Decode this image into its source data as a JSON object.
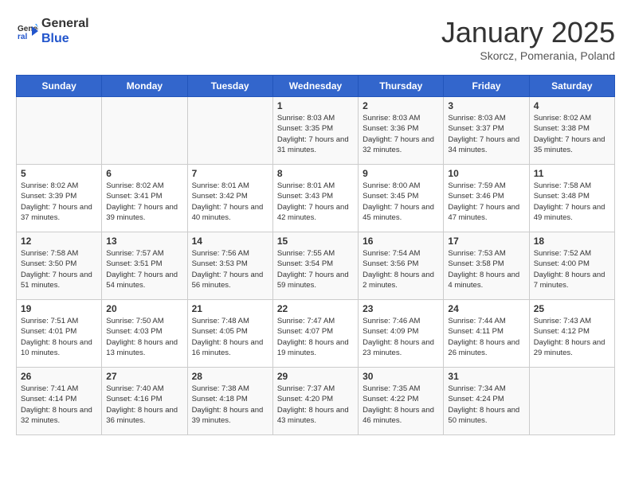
{
  "header": {
    "logo_line1": "General",
    "logo_line2": "Blue",
    "month": "January 2025",
    "location": "Skorcz, Pomerania, Poland"
  },
  "days_of_week": [
    "Sunday",
    "Monday",
    "Tuesday",
    "Wednesday",
    "Thursday",
    "Friday",
    "Saturday"
  ],
  "weeks": [
    [
      {
        "day": "",
        "text": ""
      },
      {
        "day": "",
        "text": ""
      },
      {
        "day": "",
        "text": ""
      },
      {
        "day": "1",
        "text": "Sunrise: 8:03 AM\nSunset: 3:35 PM\nDaylight: 7 hours and 31 minutes."
      },
      {
        "day": "2",
        "text": "Sunrise: 8:03 AM\nSunset: 3:36 PM\nDaylight: 7 hours and 32 minutes."
      },
      {
        "day": "3",
        "text": "Sunrise: 8:03 AM\nSunset: 3:37 PM\nDaylight: 7 hours and 34 minutes."
      },
      {
        "day": "4",
        "text": "Sunrise: 8:02 AM\nSunset: 3:38 PM\nDaylight: 7 hours and 35 minutes."
      }
    ],
    [
      {
        "day": "5",
        "text": "Sunrise: 8:02 AM\nSunset: 3:39 PM\nDaylight: 7 hours and 37 minutes."
      },
      {
        "day": "6",
        "text": "Sunrise: 8:02 AM\nSunset: 3:41 PM\nDaylight: 7 hours and 39 minutes."
      },
      {
        "day": "7",
        "text": "Sunrise: 8:01 AM\nSunset: 3:42 PM\nDaylight: 7 hours and 40 minutes."
      },
      {
        "day": "8",
        "text": "Sunrise: 8:01 AM\nSunset: 3:43 PM\nDaylight: 7 hours and 42 minutes."
      },
      {
        "day": "9",
        "text": "Sunrise: 8:00 AM\nSunset: 3:45 PM\nDaylight: 7 hours and 45 minutes."
      },
      {
        "day": "10",
        "text": "Sunrise: 7:59 AM\nSunset: 3:46 PM\nDaylight: 7 hours and 47 minutes."
      },
      {
        "day": "11",
        "text": "Sunrise: 7:58 AM\nSunset: 3:48 PM\nDaylight: 7 hours and 49 minutes."
      }
    ],
    [
      {
        "day": "12",
        "text": "Sunrise: 7:58 AM\nSunset: 3:50 PM\nDaylight: 7 hours and 51 minutes."
      },
      {
        "day": "13",
        "text": "Sunrise: 7:57 AM\nSunset: 3:51 PM\nDaylight: 7 hours and 54 minutes."
      },
      {
        "day": "14",
        "text": "Sunrise: 7:56 AM\nSunset: 3:53 PM\nDaylight: 7 hours and 56 minutes."
      },
      {
        "day": "15",
        "text": "Sunrise: 7:55 AM\nSunset: 3:54 PM\nDaylight: 7 hours and 59 minutes."
      },
      {
        "day": "16",
        "text": "Sunrise: 7:54 AM\nSunset: 3:56 PM\nDaylight: 8 hours and 2 minutes."
      },
      {
        "day": "17",
        "text": "Sunrise: 7:53 AM\nSunset: 3:58 PM\nDaylight: 8 hours and 4 minutes."
      },
      {
        "day": "18",
        "text": "Sunrise: 7:52 AM\nSunset: 4:00 PM\nDaylight: 8 hours and 7 minutes."
      }
    ],
    [
      {
        "day": "19",
        "text": "Sunrise: 7:51 AM\nSunset: 4:01 PM\nDaylight: 8 hours and 10 minutes."
      },
      {
        "day": "20",
        "text": "Sunrise: 7:50 AM\nSunset: 4:03 PM\nDaylight: 8 hours and 13 minutes."
      },
      {
        "day": "21",
        "text": "Sunrise: 7:48 AM\nSunset: 4:05 PM\nDaylight: 8 hours and 16 minutes."
      },
      {
        "day": "22",
        "text": "Sunrise: 7:47 AM\nSunset: 4:07 PM\nDaylight: 8 hours and 19 minutes."
      },
      {
        "day": "23",
        "text": "Sunrise: 7:46 AM\nSunset: 4:09 PM\nDaylight: 8 hours and 23 minutes."
      },
      {
        "day": "24",
        "text": "Sunrise: 7:44 AM\nSunset: 4:11 PM\nDaylight: 8 hours and 26 minutes."
      },
      {
        "day": "25",
        "text": "Sunrise: 7:43 AM\nSunset: 4:12 PM\nDaylight: 8 hours and 29 minutes."
      }
    ],
    [
      {
        "day": "26",
        "text": "Sunrise: 7:41 AM\nSunset: 4:14 PM\nDaylight: 8 hours and 32 minutes."
      },
      {
        "day": "27",
        "text": "Sunrise: 7:40 AM\nSunset: 4:16 PM\nDaylight: 8 hours and 36 minutes."
      },
      {
        "day": "28",
        "text": "Sunrise: 7:38 AM\nSunset: 4:18 PM\nDaylight: 8 hours and 39 minutes."
      },
      {
        "day": "29",
        "text": "Sunrise: 7:37 AM\nSunset: 4:20 PM\nDaylight: 8 hours and 43 minutes."
      },
      {
        "day": "30",
        "text": "Sunrise: 7:35 AM\nSunset: 4:22 PM\nDaylight: 8 hours and 46 minutes."
      },
      {
        "day": "31",
        "text": "Sunrise: 7:34 AM\nSunset: 4:24 PM\nDaylight: 8 hours and 50 minutes."
      },
      {
        "day": "",
        "text": ""
      }
    ]
  ]
}
